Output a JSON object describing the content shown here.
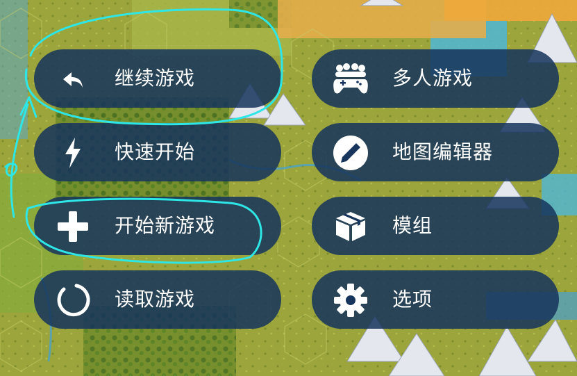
{
  "menu": {
    "continue_label": "继续游戏",
    "multiplayer_label": "多人游戏",
    "quickstart_label": "快速开始",
    "map_editor_label": "地图编辑器",
    "new_game_label": "开始新游戏",
    "mods_label": "模组",
    "load_label": "读取游戏",
    "options_label": "选项"
  },
  "icons": {
    "continue": "back-arrow-icon",
    "multiplayer": "multiplayer-people-controller-icon",
    "quickstart": "lightning-bolt-icon",
    "map_editor": "pencil-icon",
    "new_game": "plus-icon",
    "mods": "box-icon",
    "load": "loading-circle-icon",
    "options": "gear-icon"
  },
  "colors": {
    "button_bg": "#16345c",
    "button_text": "#ffffff",
    "annotation": "#2ee6e6",
    "grass": "#9aa63a",
    "mountain": "#dfe3ea",
    "water": "#4aa8d8",
    "desert": "#e9b24a"
  }
}
